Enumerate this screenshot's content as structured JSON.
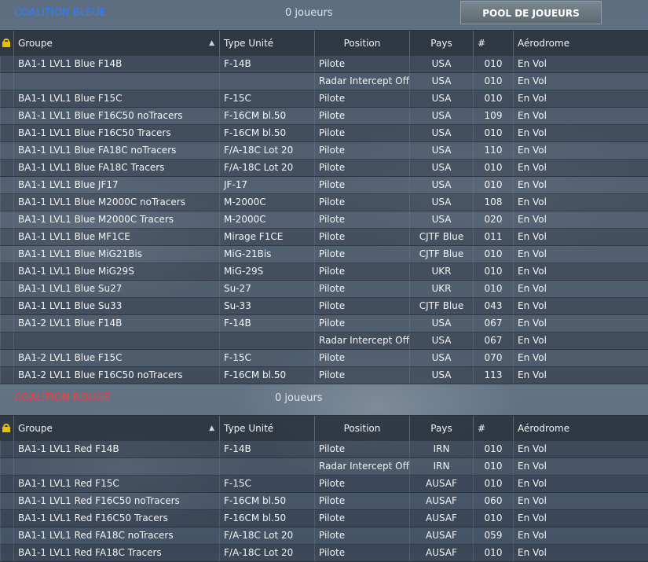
{
  "blue": {
    "name": "COALITION BLEUE",
    "players": "0 joueurs",
    "pool_button": "POOL DE JOUEURS",
    "columns": [
      "Groupe",
      "Type Unité",
      "Position",
      "Pays",
      "#",
      "Aérodrome"
    ],
    "rows": [
      [
        "BA1-1 LVL1 Blue F14B",
        "F-14B",
        "Pilote",
        "USA",
        "010",
        "En Vol"
      ],
      [
        "",
        "",
        "Radar Intercept Officer",
        "USA",
        "010",
        "En Vol"
      ],
      [
        "BA1-1 LVL1 Blue F15C",
        "F-15C",
        "Pilote",
        "USA",
        "010",
        "En Vol"
      ],
      [
        "BA1-1 LVL1 Blue F16C50 noTracers",
        "F-16CM bl.50",
        "Pilote",
        "USA",
        "109",
        "En Vol"
      ],
      [
        "BA1-1 LVL1 Blue F16C50 Tracers",
        "F-16CM bl.50",
        "Pilote",
        "USA",
        "010",
        "En Vol"
      ],
      [
        "BA1-1 LVL1 Blue FA18C noTracers",
        "F/A-18C Lot 20",
        "Pilote",
        "USA",
        "110",
        "En Vol"
      ],
      [
        "BA1-1 LVL1 Blue FA18C Tracers",
        "F/A-18C Lot 20",
        "Pilote",
        "USA",
        "010",
        "En Vol"
      ],
      [
        "BA1-1 LVL1 Blue JF17",
        "JF-17",
        "Pilote",
        "USA",
        "010",
        "En Vol"
      ],
      [
        "BA1-1 LVL1 Blue M2000C noTracers",
        "M-2000C",
        "Pilote",
        "USA",
        "108",
        "En Vol"
      ],
      [
        "BA1-1 LVL1 Blue M2000C Tracers",
        "M-2000C",
        "Pilote",
        "USA",
        "020",
        "En Vol"
      ],
      [
        "BA1-1 LVL1 Blue MF1CE",
        "Mirage F1CE",
        "Pilote",
        "CJTF Blue",
        "011",
        "En Vol"
      ],
      [
        "BA1-1 LVL1 Blue MiG21Bis",
        "MiG-21Bis",
        "Pilote",
        "CJTF Blue",
        "010",
        "En Vol"
      ],
      [
        "BA1-1 LVL1 Blue MiG29S",
        "MiG-29S",
        "Pilote",
        "UKR",
        "010",
        "En Vol"
      ],
      [
        "BA1-1 LVL1 Blue Su27",
        "Su-27",
        "Pilote",
        "UKR",
        "010",
        "En Vol"
      ],
      [
        "BA1-1 LVL1 Blue Su33",
        "Su-33",
        "Pilote",
        "CJTF Blue",
        "043",
        "En Vol"
      ],
      [
        "BA1-2 LVL1 Blue F14B",
        "F-14B",
        "Pilote",
        "USA",
        "067",
        "En Vol"
      ],
      [
        "",
        "",
        "Radar Intercept Officer",
        "USA",
        "067",
        "En Vol"
      ],
      [
        "BA1-2 LVL1 Blue F15C",
        "F-15C",
        "Pilote",
        "USA",
        "070",
        "En Vol"
      ],
      [
        "BA1-2 LVL1 Blue F16C50 noTracers",
        "F-16CM bl.50",
        "Pilote",
        "USA",
        "113",
        "En Vol"
      ]
    ]
  },
  "red": {
    "name": "COALITION ROUGE",
    "players": "0 joueurs",
    "columns": [
      "Groupe",
      "Type Unité",
      "Position",
      "Pays",
      "#",
      "Aérodrome"
    ],
    "rows": [
      [
        "BA1-1 LVL1 Red F14B",
        "F-14B",
        "Pilote",
        "IRN",
        "010",
        "En Vol"
      ],
      [
        "",
        "",
        "Radar Intercept Officer",
        "IRN",
        "010",
        "En Vol"
      ],
      [
        "BA1-1 LVL1 Red F15C",
        "F-15C",
        "Pilote",
        "AUSAF",
        "010",
        "En Vol"
      ],
      [
        "BA1-1 LVL1 Red F16C50 noTracers",
        "F-16CM bl.50",
        "Pilote",
        "AUSAF",
        "060",
        "En Vol"
      ],
      [
        "BA1-1 LVL1 Red F16C50 Tracers",
        "F-16CM bl.50",
        "Pilote",
        "AUSAF",
        "010",
        "En Vol"
      ],
      [
        "BA1-1 LVL1 Red FA18C noTracers",
        "F/A-18C Lot 20",
        "Pilote",
        "AUSAF",
        "059",
        "En Vol"
      ],
      [
        "BA1-1 LVL1 Red FA18C Tracers",
        "F/A-18C Lot 20",
        "Pilote",
        "AUSAF",
        "010",
        "En Vol"
      ]
    ]
  },
  "icons": {
    "lock": "lock-icon",
    "sort": "sort-up-icon"
  },
  "colors": {
    "blue_coalition": "#2f7dff",
    "red_coalition": "#ff3b3b",
    "lock": "#e8c200"
  }
}
